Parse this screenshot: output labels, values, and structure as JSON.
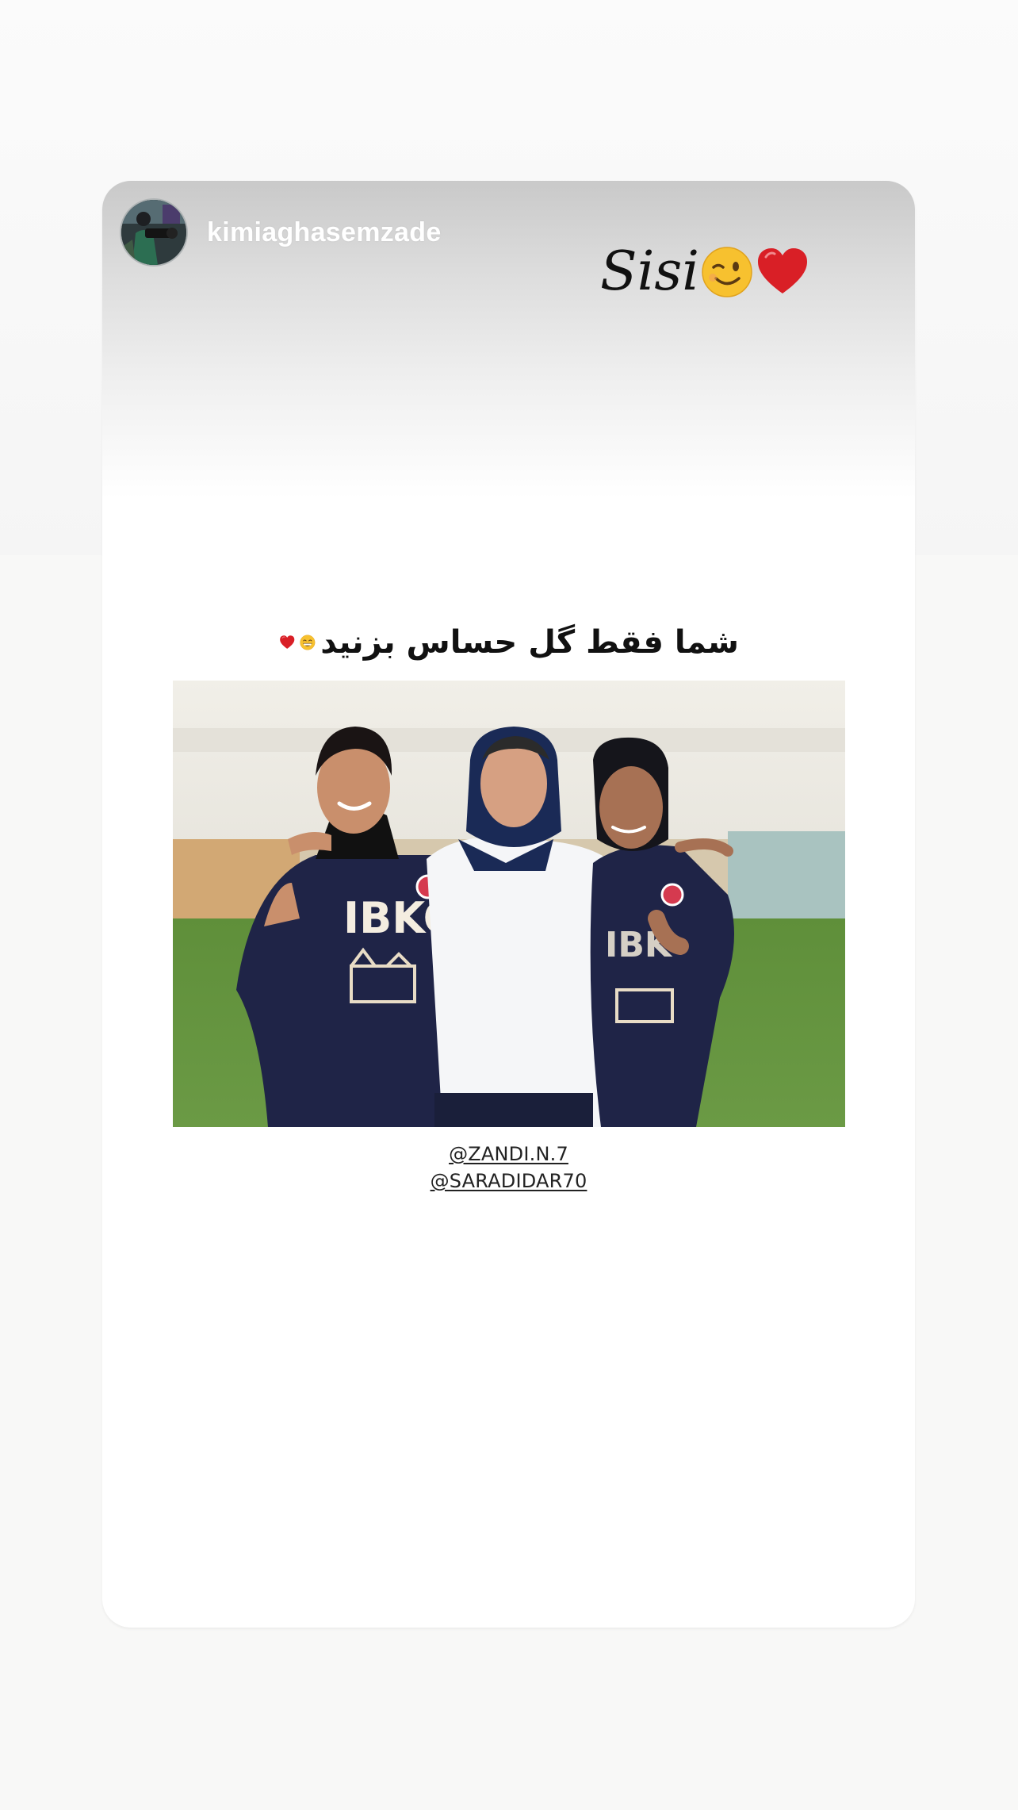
{
  "story": {
    "username": "kimiaghasemzade",
    "avatar_icon": "profile-avatar",
    "sticker": {
      "text": "Sisi",
      "emojis": [
        "winking-face-icon",
        "red-heart-icon"
      ]
    },
    "caption": {
      "text": "شما فقط گل حساس بزنید",
      "emojis": [
        "grinning-face-icon",
        "red-heart-icon"
      ]
    },
    "photo": {
      "jersey_text": "IBKO"
    },
    "mentions": [
      "@ZANDI.N.7",
      "@SARADIDAR70"
    ]
  },
  "colors": {
    "card_background": "#ffffff",
    "header_gradient_top": "#c9c9c9",
    "page_background": "#f8f8f7",
    "jersey_navy": "#1f2447",
    "heart_red": "#d91f26",
    "emoji_yellow": "#f7c12f"
  }
}
